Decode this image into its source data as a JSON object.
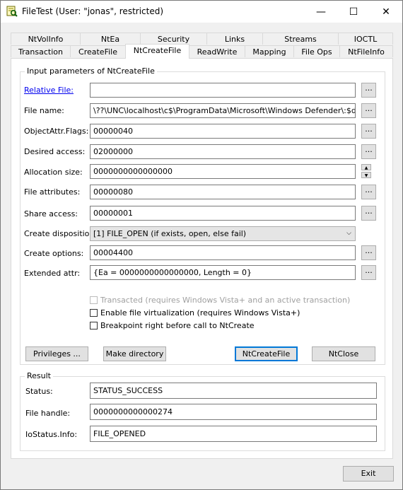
{
  "window": {
    "title": "FileTest (User: \"jonas\", restricted)",
    "minimize": "—",
    "maximize": "☐",
    "close": "✕"
  },
  "tabs_back": [
    "NtVolInfo",
    "NtEa",
    "Security",
    "Links",
    "Streams",
    "IOCTL"
  ],
  "tabs_front": [
    "Transaction",
    "CreateFile",
    "NtCreateFile",
    "ReadWrite",
    "Mapping",
    "File Ops",
    "NtFileInfo"
  ],
  "active_tab": "NtCreateFile",
  "input_group": {
    "legend": "Input parameters of NtCreateFile",
    "browse": "...",
    "fields": [
      {
        "label": "Relative File:",
        "value": ""
      },
      {
        "label": "File name:",
        "value": "\\??\\UNC\\localhost\\c$\\ProgramData\\Microsoft\\Windows Defender\\:$data"
      },
      {
        "label": "ObjectAttr.Flags:",
        "value": "00000040"
      },
      {
        "label": "Desired access:",
        "value": "02000000"
      },
      {
        "label": "Allocation size:",
        "value": "0000000000000000"
      },
      {
        "label": "File attributes:",
        "value": "00000080"
      },
      {
        "label": "Share access:",
        "value": "00000001"
      },
      {
        "label": "Create disposition:",
        "value": "[1] FILE_OPEN (if exists, open, else fail)"
      },
      {
        "label": "Create options:",
        "value": "00004400"
      },
      {
        "label": "Extended attr:",
        "value": "{Ea = 0000000000000000, Length = 0}"
      }
    ],
    "checkboxes": [
      {
        "label": "Transacted (requires Windows Vista+ and an active transaction)",
        "checked": false,
        "enabled": false
      },
      {
        "label": "Enable file virtualization (requires Windows Vista+)",
        "checked": false,
        "enabled": true
      },
      {
        "label": "Breakpoint right before call to NtCreate",
        "checked": false,
        "enabled": true
      }
    ],
    "buttons": {
      "privileges": "Privileges ...",
      "make_directory": "Make directory",
      "ntcreatefile": "NtCreateFile",
      "ntclose": "NtClose"
    }
  },
  "result_group": {
    "legend": "Result",
    "fields": [
      {
        "label": "Status:",
        "value": "STATUS_SUCCESS"
      },
      {
        "label": "File handle:",
        "value": "0000000000000274"
      },
      {
        "label": "IoStatus.Info:",
        "value": "FILE_OPENED"
      }
    ]
  },
  "exit_label": "Exit"
}
